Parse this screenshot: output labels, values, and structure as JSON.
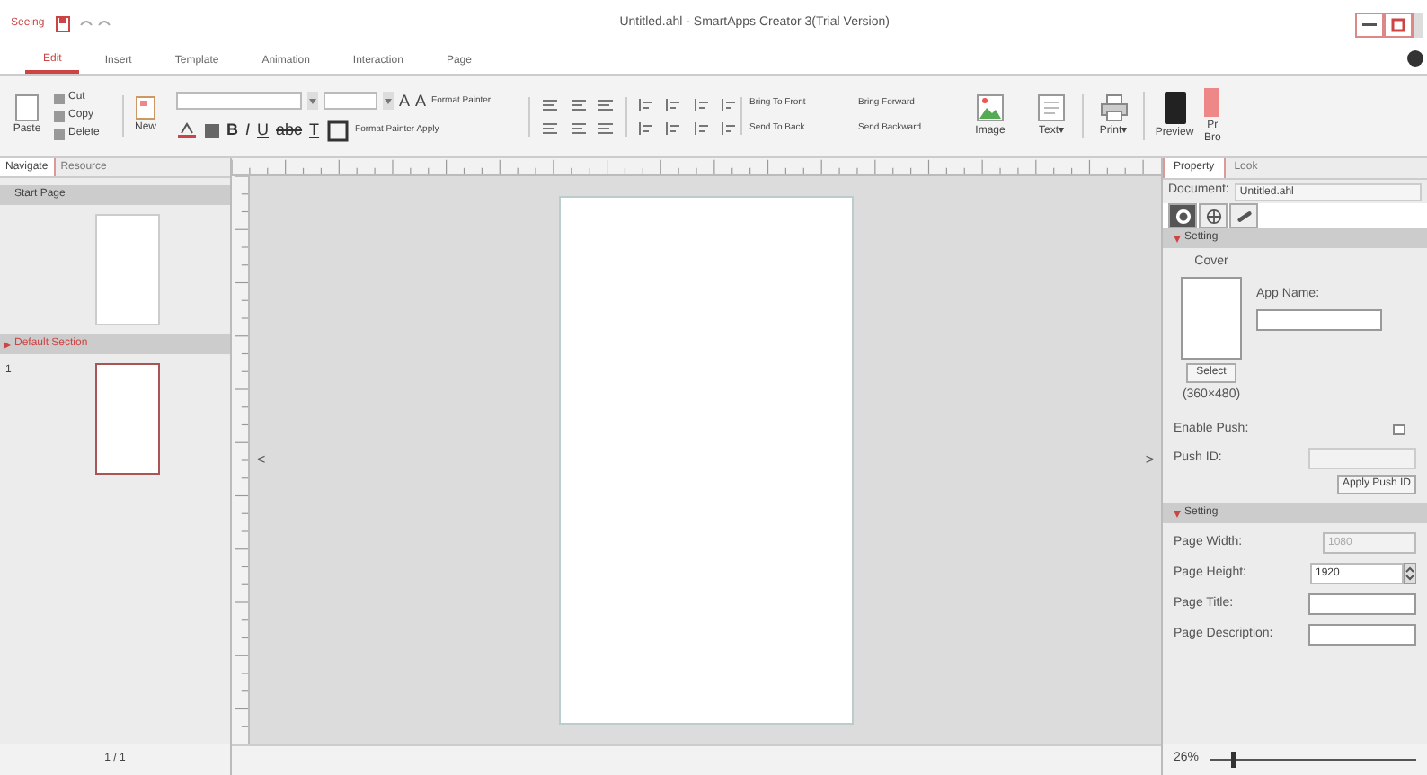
{
  "app": {
    "logo": "Seeing",
    "title": "Untitled.ahl - SmartApps Creator 3(Trial Version)"
  },
  "menu_tabs": [
    {
      "label": "Edit",
      "selected": true
    },
    {
      "label": "Insert",
      "selected": false
    },
    {
      "label": "Template",
      "selected": false
    },
    {
      "label": "Animation",
      "selected": false
    },
    {
      "label": "Interaction",
      "selected": false
    },
    {
      "label": "Page",
      "selected": false
    }
  ],
  "ribbon": {
    "paste": "Paste",
    "clipboard": [
      "Cut",
      "Copy",
      "Delete"
    ],
    "new": "New",
    "font_marks": [
      "A",
      "A"
    ],
    "format": [
      "Format Painter",
      "Format Painter Apply"
    ],
    "styles": [
      "B",
      "I",
      "U",
      "abc",
      "T"
    ],
    "arrange": [
      "Bring To Front",
      "Bring Forward",
      "Send To Back",
      "Send Backward"
    ],
    "big": [
      {
        "label": "Image",
        "kind": "image"
      },
      {
        "label": "Text▾",
        "kind": "text"
      },
      {
        "label": "Print▾",
        "kind": "print"
      },
      {
        "label": "Preview",
        "kind": "preview"
      },
      {
        "label": "Pr\nBro",
        "kind": "cut"
      }
    ]
  },
  "left_panel": {
    "tabs": [
      {
        "label": "Navigate",
        "selected": true
      },
      {
        "label": "Resource",
        "selected": false
      }
    ],
    "start_page": "Start Page",
    "section": "Default Section",
    "page_number": "1",
    "footer": "1 / 1"
  },
  "canvas": {
    "collapse_left": "<",
    "collapse_right": ">"
  },
  "right_panel": {
    "tabs": [
      {
        "label": "Property",
        "selected": true
      },
      {
        "label": "Look",
        "selected": false
      }
    ],
    "document_label": "Document:",
    "document_value": "Untitled.ahl",
    "icon_tabs": [
      {
        "kind": "gear",
        "selected": true
      },
      {
        "kind": "globe",
        "selected": false
      },
      {
        "kind": "link",
        "selected": false
      }
    ],
    "section1": "Setting",
    "cover": "Cover",
    "select": "Select",
    "cover_size": "(360×480)",
    "app_name": "App Name:",
    "enable_push": "Enable Push:",
    "push_checked": false,
    "push_id": "Push ID:",
    "apply_push": "Apply Push ID",
    "section2": "Setting",
    "page_width": "Page Width:",
    "page_width_value": "1080",
    "page_height": "Page Height:",
    "page_height_value": "1920",
    "page_title": "Page Title:",
    "page_description": "Page Description:"
  },
  "zoom": {
    "reading": "26%",
    "level": 0.1
  }
}
